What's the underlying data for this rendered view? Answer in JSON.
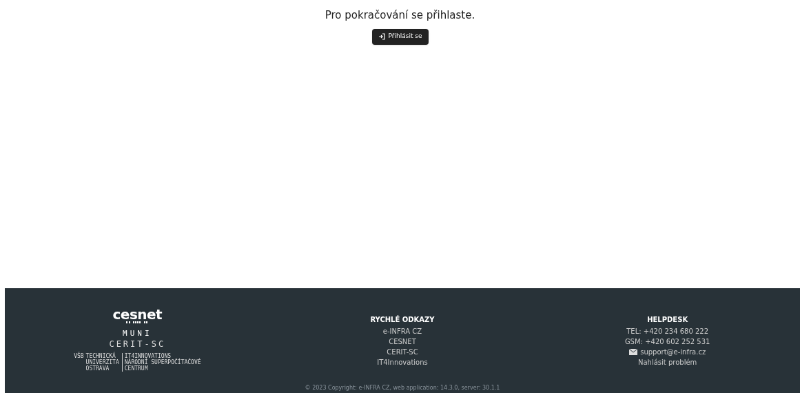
{
  "prompt": {
    "message": "Pro pokračování se přihlaste.",
    "login_button": "Přihlásit se"
  },
  "footer": {
    "logos": {
      "cesnet": "cesnet",
      "muni": "MUNI",
      "cerit": "CERIT-SC",
      "vsb": [
        "VŠB",
        "TECHNICKÁ",
        "UNIVERZITA",
        "OSTRAVA"
      ],
      "it4i": [
        "IT4INNOVATIONS",
        "NÁRODNÍ SUPERPOČÍTAČOVÉ",
        "CENTRUM"
      ]
    },
    "quick_links": {
      "title": "RYCHLÉ ODKAZY",
      "links": [
        "e-INFRA CZ",
        "CESNET",
        "CERIT-SC",
        "IT4Innovations"
      ]
    },
    "helpdesk": {
      "title": "HELPDESK",
      "tel": "TEL: +420 234 680 222",
      "gsm": "GSM: +420 602 252 531",
      "email": "support@e-infra.cz",
      "report": "Nahlásit problém"
    },
    "copyright": "© 2023 Copyright: e-INFRA CZ, web application: 14.3.0, server: 30.1.1"
  }
}
